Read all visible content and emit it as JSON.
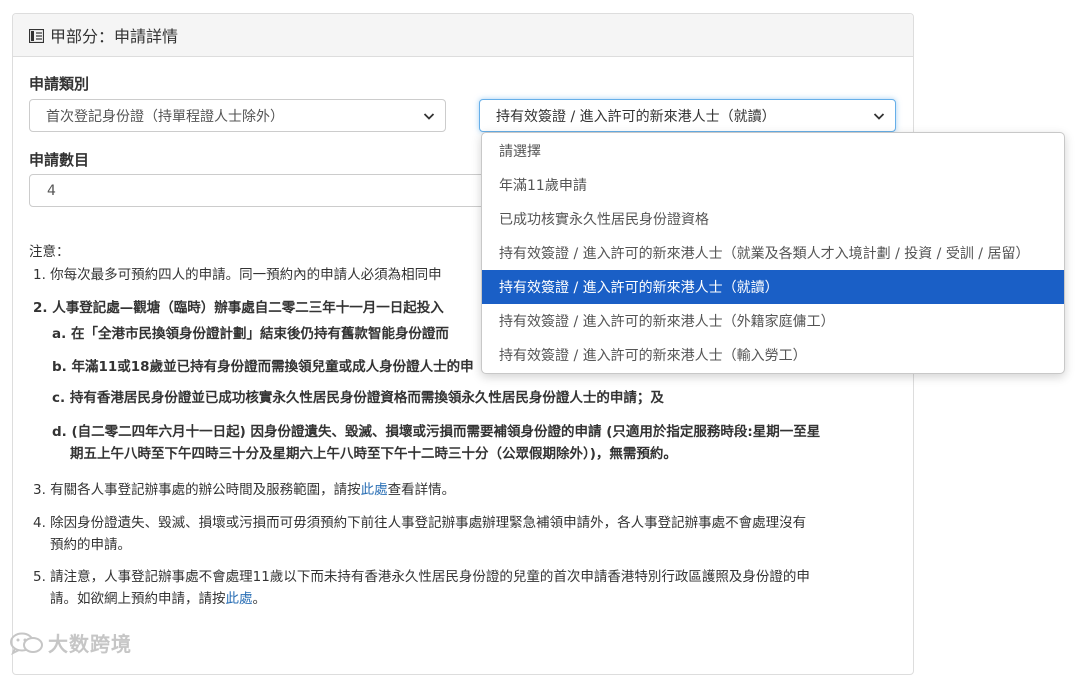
{
  "panel": {
    "title": "甲部分：申請詳情",
    "icon": "book-icon"
  },
  "form": {
    "category_label": "申請類別",
    "category_select_value": "首次登記身份證（持單程證人士除外）",
    "subcategory_select_value": "持有效簽證 / 進入許可的新來港人士（就讀）",
    "count_label": "申請數目",
    "count_value": "4"
  },
  "dropdown": {
    "options": [
      "請選擇",
      "年滿11歲申請",
      "已成功核實永久性居民身份證資格",
      "持有效簽證 / 進入許可的新來港人士（就業及各類人才入境計劃 / 投資 / 受訓 / 居留）",
      "持有效簽證 / 進入許可的新來港人士（就讀）",
      "持有效簽證 / 進入許可的新來港人士（外籍家庭傭工）",
      "持有效簽證 / 進入許可的新來港人士（輸入勞工）"
    ],
    "selected_index": 4,
    "selected_color": "#1a5fc6"
  },
  "notes": {
    "heading": "注意：",
    "n1": "1. 你每次最多可預約四人的申請。同一預約內的申請人必須為相同申",
    "n2": "2. 人事登記處—觀塘（臨時）辦事處自二零二三年十一月一日起投入",
    "n2a": "a. 在「全港市民換領身份證計劃」結束後仍持有舊款智能身份證而",
    "n2b": "b. 年滿11或18歲並已持有身份證而需換領兒童或成人身份證人士的申",
    "n2c": "c. 持有香港居民身份證並已成功核實永久性居民身份證資格而需換領永久性居民身份證人士的申請；及",
    "n2d_line1": "d. (自二零二四年六月十一日起) 因身份證遺失、毀滅、損壞或污損而需要補領身份證的申請 (只適用於指定服務時段:星期一至星",
    "n2d_line2": "期五上午八時至下午四時三十分及星期六上午八時至下午十二時三十分（公眾假期除外）)，無需預約。",
    "n3_pre": "3. 有關各人事登記辦事處的辦公時間及服務範圍，請按",
    "n3_link": "此處",
    "n3_post": "查看詳情。",
    "n4_line1": "4. 除因身份證遺失、毀滅、損壞或污損而可毋須預約下前往人事登記辦事處辦理緊急補領申請外，各人事登記辦事處不會處理沒有",
    "n4_line2": "預約的申請。",
    "n5_line1": "5. 請注意，人事登記辦事處不會處理11歲以下而未持有香港永久性居民身份證的兒童的首次申請香港特別行政區護照及身份證的申",
    "n5_line2_pre": "請。如欲網上預約申請，請按",
    "n5_link": "此處",
    "n5_line2_post": "。"
  },
  "watermark": {
    "text": "大数跨境",
    "icon": "wechat-logo-icon"
  }
}
